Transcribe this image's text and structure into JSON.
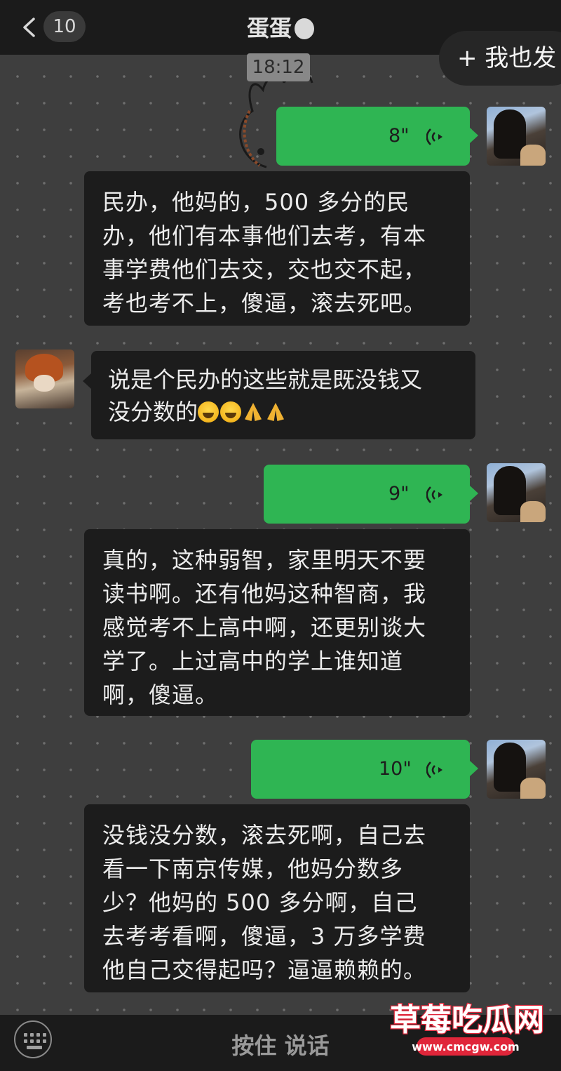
{
  "header": {
    "unread_count": "10",
    "contact_name": "蛋蛋",
    "follow_button": "+ 我也发"
  },
  "timestamp": "18:12",
  "messages": [
    {
      "type": "voice",
      "duration": "8\""
    },
    {
      "type": "transcript",
      "text": "民办，他妈的，500 多分的民\n办，他们有本事他们去考，有本\n事学费他们去交，交也交不起，\n考也考不上，傻逼，滚去死吧。"
    },
    {
      "type": "received",
      "text_line1": "说是个民办的这些就是既没钱又",
      "text_line2": "没分数的",
      "emojis": [
        "loudly-crying-face",
        "loudly-crying-face",
        "folded-hands",
        "folded-hands"
      ]
    },
    {
      "type": "voice",
      "duration": "9\""
    },
    {
      "type": "transcript",
      "text": "真的，这种弱智，家里明天不要\n读书啊。还有他妈这种智商，我\n感觉考不上高中啊，还更别谈大\n学了。上过高中的学上谁知道\n啊，傻逼。"
    },
    {
      "type": "voice",
      "duration": "10\""
    },
    {
      "type": "transcript",
      "text": "没钱没分数，滚去死啊，自己去\n看一下南京传媒，他妈分数多\n少？他妈的 500 多分啊，自己\n去考考看啊，傻逼，3 万多学费\n他自己交得起吗？逼逼赖赖的。"
    }
  ],
  "input_bar": {
    "hold_to_talk": "按住 说话"
  },
  "watermark": {
    "title": "草莓吃瓜网",
    "url": "www.cmcgw.com"
  },
  "colors": {
    "voice_bubble": "#2fb553",
    "text_bubble": "#1c1c1c",
    "background": "#3e3e3e"
  }
}
